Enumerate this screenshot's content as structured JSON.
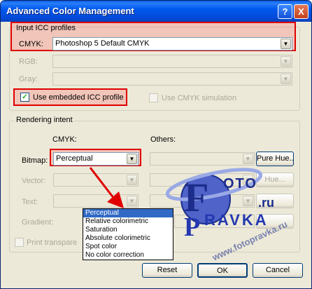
{
  "window": {
    "title": "Advanced Color Management",
    "help_glyph": "?",
    "close_glyph": "X"
  },
  "input_icc": {
    "group_label": "Input ICC profiles",
    "cmyk_label": "CMYK:",
    "cmyk_value": "Photoshop 5 Default CMYK",
    "rgb_label": "RGB:",
    "gray_label": "Gray:",
    "use_embedded_label": "Use embedded ICC profile",
    "use_embedded_checked": true,
    "use_cmyk_sim_label": "Use CMYK simulation"
  },
  "rendering": {
    "group_label": "Rendering intent",
    "cmyk_col": "CMYK:",
    "others_col": "Others:",
    "bitmap_label": "Bitmap:",
    "bitmap_value": "Perceptual",
    "vector_label": "Vector:",
    "text_label": "Text:",
    "gradient_label": "Gradient:",
    "pure_hue_label": "Pure Hue...",
    "pure_hue_vector": "Hue...",
    "print_transparent_label": "Print transpare"
  },
  "dropdown": {
    "options": [
      "Perceptual",
      "Relative colorimetric",
      "Saturation",
      "Absolute colorimetric",
      "Spot color",
      "No color correction"
    ],
    "selected_index": 0
  },
  "buttons": {
    "reset": "Reset",
    "ok": "OK",
    "cancel": "Cancel"
  },
  "watermark": {
    "line1": "OTO",
    "line2": "RAVKA",
    "suffix": ".ru",
    "url": "www.fotopravka.ru"
  },
  "colors": {
    "annotation": "#e00000",
    "accent": "#316ac5"
  }
}
